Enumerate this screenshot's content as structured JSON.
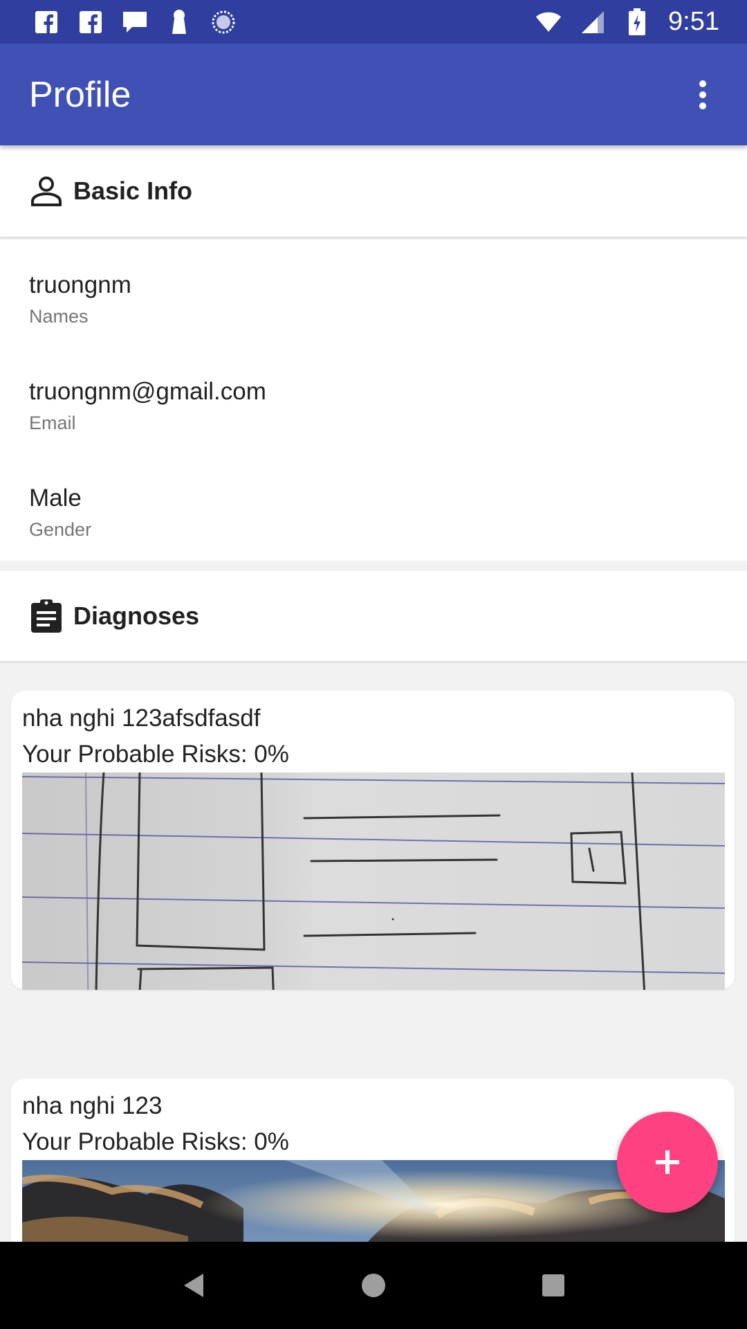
{
  "status_bar": {
    "time": "9:51",
    "left_icons": [
      "facebook-icon",
      "facebook-icon",
      "message-icon",
      "keyhole-icon",
      "sync-icon"
    ],
    "right_icons": [
      "wifi-icon",
      "cell-signal-icon",
      "battery-charging-icon"
    ]
  },
  "app_bar": {
    "title": "Profile",
    "menu_icon": "more-vert-icon"
  },
  "basic_info": {
    "header": "Basic Info",
    "icon": "person-icon",
    "rows": [
      {
        "value": "truongnm",
        "label": "Names"
      },
      {
        "value": "truongnm@gmail.com",
        "label": "Email"
      },
      {
        "value": "Male",
        "label": "Gender"
      }
    ]
  },
  "diagnoses": {
    "header": "Diagnoses",
    "icon": "clipboard-icon",
    "items": [
      {
        "title": "nha nghi 123afsdfasdf",
        "risk": "Your Probable Risks: 0%",
        "image": "notebook-sketch-photo"
      },
      {
        "title": "nha nghi 123",
        "risk": "Your Probable Risks: 0%",
        "image": "cloudy-sky-photo"
      }
    ]
  },
  "fab": {
    "icon": "add-icon"
  },
  "nav_bar": {
    "icons": [
      "back-icon",
      "home-icon",
      "recents-icon"
    ]
  },
  "colors": {
    "status_bar": "#303f9f",
    "app_bar": "#3f51b5",
    "fab": "#ff4081",
    "background": "#f2f2f2"
  }
}
